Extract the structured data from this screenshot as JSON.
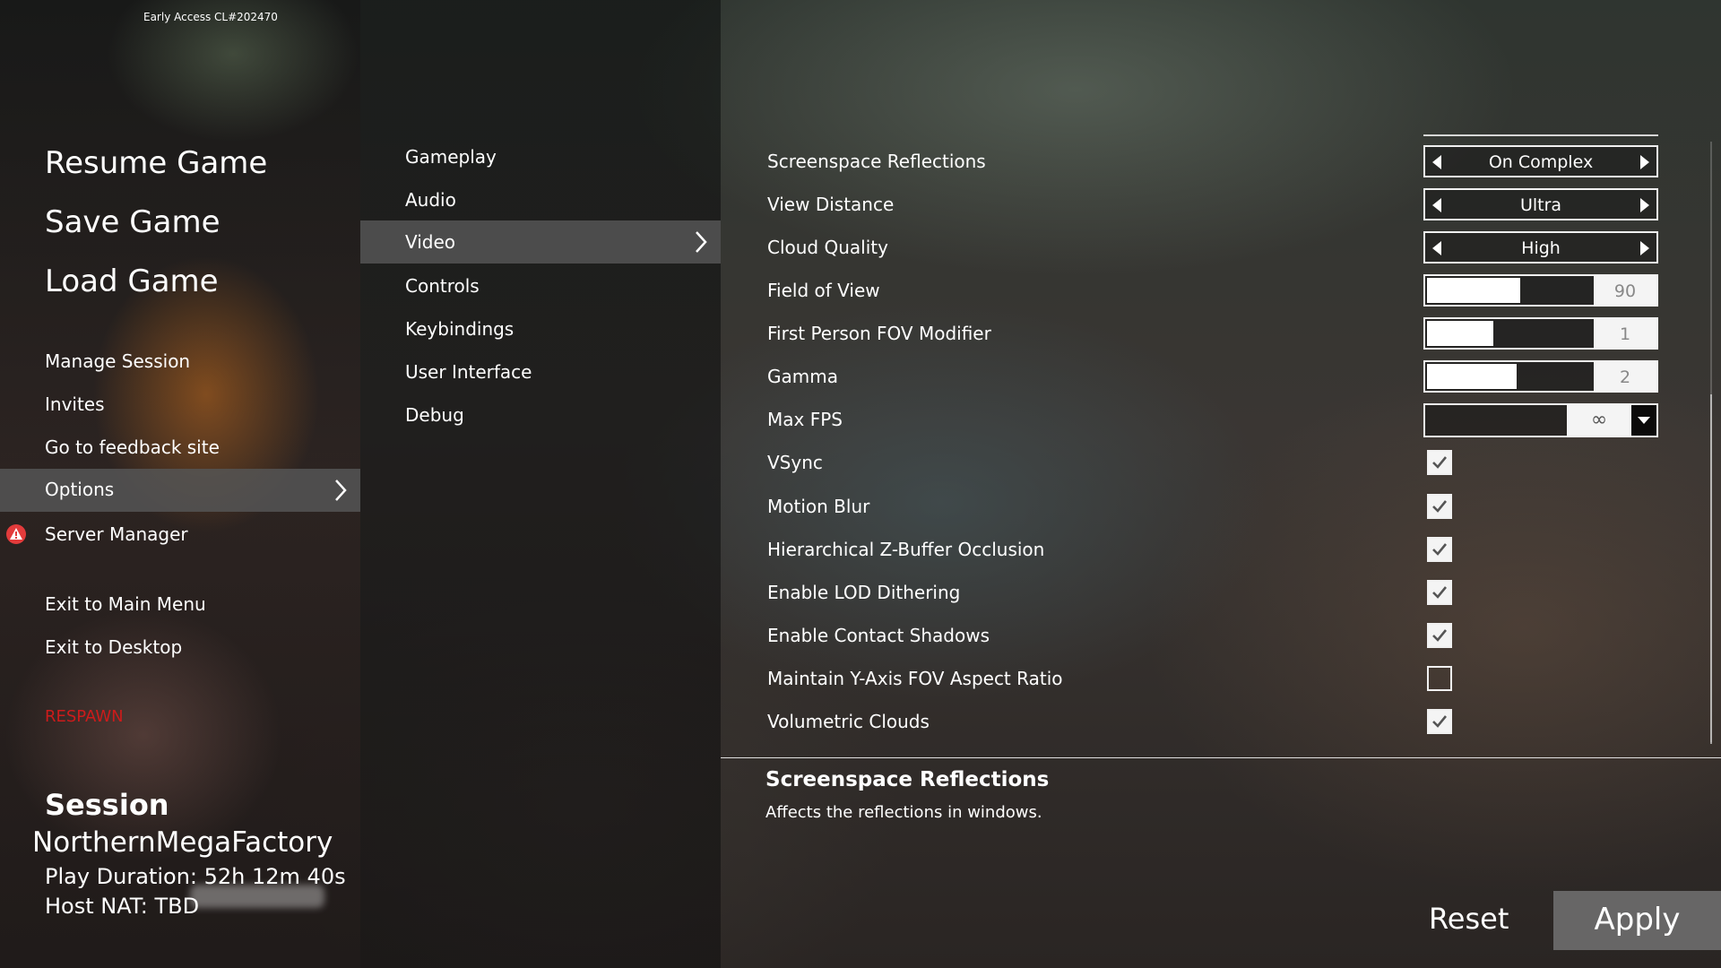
{
  "build": "Early Access CL#202470",
  "left_menu": {
    "main": [
      "Resume Game",
      "Save Game",
      "Load Game"
    ],
    "secondary": [
      "Manage Session",
      "Invites",
      "Go to feedback site"
    ],
    "options": "Options",
    "server_manager": "Server Manager",
    "exit_main": "Exit to Main Menu",
    "exit_desktop": "Exit to Desktop",
    "respawn": "RESPAWN"
  },
  "session": {
    "title": "Session",
    "name": "NorthernMegaFactory",
    "play_duration": "Play Duration: 52h 12m 40s",
    "host_nat": "Host NAT: TBD"
  },
  "categories": [
    "Gameplay",
    "Audio",
    "Video",
    "Controls",
    "Keybindings",
    "User Interface",
    "Debug"
  ],
  "selected_category": "Video",
  "settings": {
    "screenspace_reflections": {
      "label": "Screenspace Reflections",
      "value": "On Complex"
    },
    "view_distance": {
      "label": "View Distance",
      "value": "Ultra"
    },
    "cloud_quality": {
      "label": "Cloud Quality",
      "value": "High"
    },
    "field_of_view": {
      "label": "Field of View",
      "value": "90",
      "fill_percent": 56
    },
    "fp_fov_modifier": {
      "label": "First Person FOV Modifier",
      "value": "1",
      "fill_percent": 40
    },
    "gamma": {
      "label": "Gamma",
      "value": "2",
      "fill_percent": 54
    },
    "max_fps": {
      "label": "Max FPS",
      "value": "∞"
    },
    "vsync": {
      "label": "VSync",
      "checked": true
    },
    "motion_blur": {
      "label": "Motion Blur",
      "checked": true
    },
    "hzb_occlusion": {
      "label": "Hierarchical Z-Buffer Occlusion",
      "checked": true
    },
    "lod_dithering": {
      "label": "Enable LOD Dithering",
      "checked": true
    },
    "contact_shadows": {
      "label": "Enable Contact Shadows",
      "checked": true
    },
    "y_axis_fov": {
      "label": "Maintain Y-Axis FOV Aspect Ratio",
      "checked": false
    },
    "volumetric_clouds": {
      "label": "Volumetric Clouds",
      "checked": true
    }
  },
  "description": {
    "title": "Screenspace Reflections",
    "text": "Affects the reflections in windows."
  },
  "buttons": {
    "reset": "Reset",
    "apply": "Apply"
  },
  "colors": {
    "accent_highlight": "#555555",
    "respawn": "#cc1b1b",
    "apply_bg": "#6e6e6e"
  }
}
